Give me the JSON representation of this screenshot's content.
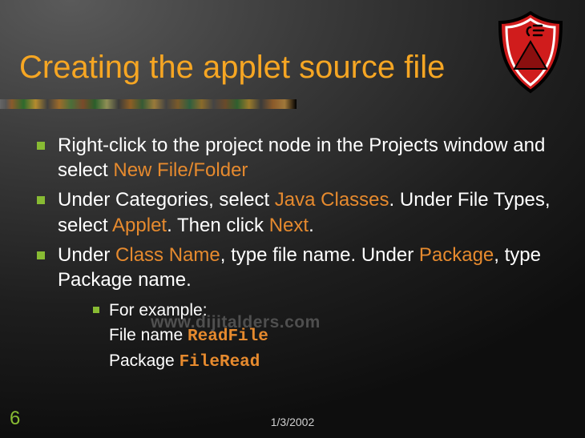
{
  "title": "Creating the applet source file",
  "bullets": [
    {
      "pre": "Right-click to the project node in the Projects window and select ",
      "h1": "New File/Folder"
    },
    {
      "pre": "Under Categories, select ",
      "h1": "Java Classes",
      "mid1": ". Under File Types, select ",
      "h2": "Applet",
      "mid2": ". Then click ",
      "h3": "Next",
      "post": "."
    },
    {
      "pre": "Under ",
      "h1": "Class Name",
      "mid1": ", type file name. Under ",
      "h2": "Package",
      "post": ", type Package name."
    }
  ],
  "subbullet": {
    "line1": "For example:",
    "line2_label": "File name ",
    "line2_value": "ReadFile",
    "line3_label": "Package ",
    "line3_value": "FileRead"
  },
  "watermark": "www.dijitalders.com",
  "page_number": "6",
  "footer_date": "1/3/2002"
}
